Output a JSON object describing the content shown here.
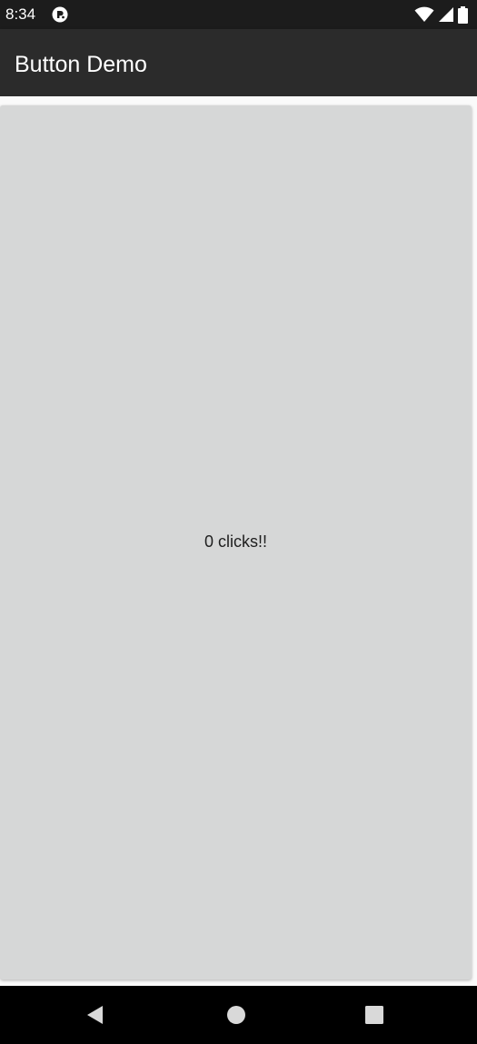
{
  "status_bar": {
    "time": "8:34",
    "icons": [
      "app-notification-icon",
      "wifi-icon",
      "cell-signal-icon",
      "battery-icon"
    ]
  },
  "app_bar": {
    "title": "Button Demo"
  },
  "main": {
    "button_label": "0 clicks!!"
  },
  "nav_bar": {
    "icons": [
      "back-icon",
      "home-icon",
      "recents-icon"
    ]
  },
  "colors": {
    "status_bar": "#1c1c1c",
    "app_bar": "#2b2b2b",
    "button_bg": "#d6d7d7",
    "nav_bar": "#000000"
  }
}
